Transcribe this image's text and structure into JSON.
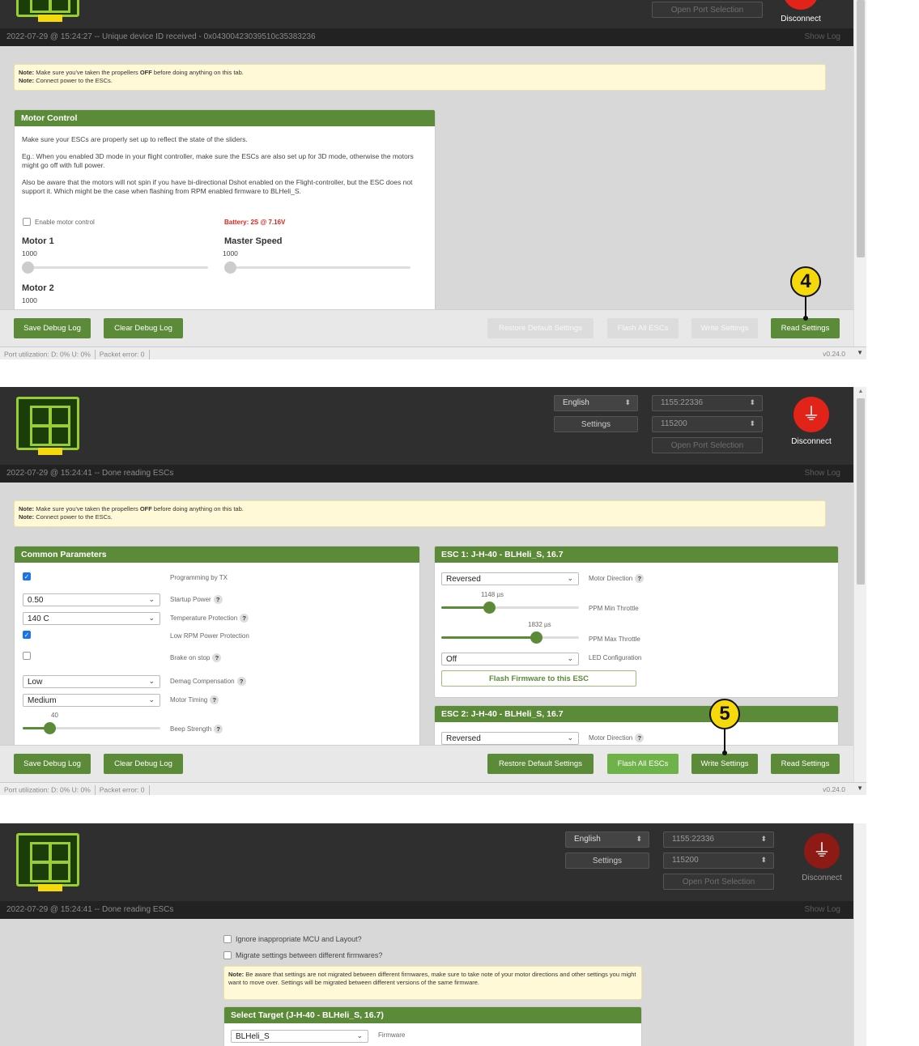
{
  "header": {
    "language": "English",
    "settings_label": "Settings",
    "port": "1155:22336",
    "baud": "115200",
    "open_port_label": "Open Port Selection",
    "disconnect_label": "Disconnect"
  },
  "log": {
    "panel1": "2022-07-29 @ 15:24:27 -- Unique device ID received - 0x04300423039510c35383236",
    "panel2": "2022-07-29 @ 15:24:41 -- Done reading ESCs",
    "panel3": "2022-07-29 @ 15:24:41 -- Done reading ESCs",
    "show_log": "Show Log"
  },
  "notes": {
    "line1_bold": "Note:",
    "line1_a": " Make sure you've taken the propellers ",
    "line1_off": "OFF",
    "line1_b": " before doing anything on this tab.",
    "line2_bold": "Note:",
    "line2": " Connect power to the ESCs."
  },
  "motor_control": {
    "title": "Motor Control",
    "p1": "Make sure your ESCs are properly set up to reflect the state of the sliders.",
    "p2": "Eg.: When you enabled 3D mode in your flight controller, make sure the ESCs are also set up for 3D mode, otherwise the motors might go off with full power.",
    "p3": "Also be aware that the motors will not spin if you have bi-directional Dshot enabled on the Flight-controller, but the ESC does not support it. Which might be the case when flashing from RPM enabled firmware to BLHeli_S.",
    "enable_label": "Enable motor control",
    "battery": "Battery: 2S @ 7.16V",
    "motor1": "Motor 1",
    "motor1_val": "1000",
    "master": "Master Speed",
    "master_val": "1000",
    "motor2": "Motor 2",
    "motor2_val": "1000"
  },
  "toolbar": {
    "save_debug": "Save Debug Log",
    "clear_debug": "Clear Debug Log",
    "restore": "Restore Default Settings",
    "flash_all": "Flash All ESCs",
    "write": "Write Settings",
    "read": "Read Settings"
  },
  "status": {
    "port_util": "Port utilization: D: 0% U: 0%",
    "packet_error": "Packet error: 0",
    "version": "v0.24.0"
  },
  "callouts": {
    "four": "4",
    "five": "5"
  },
  "common": {
    "title": "Common Parameters",
    "programming_by_tx": "Programming by TX",
    "startup_power_val": "0.50",
    "startup_power": "Startup Power",
    "temp_val": "140 C",
    "temp": "Temperature Protection",
    "low_rpm": "Low RPM Power Protection",
    "brake": "Brake on stop",
    "demag_val": "Low",
    "demag": "Demag Compensation",
    "timing_val": "Medium",
    "timing": "Motor Timing",
    "beep_val": "40",
    "beep": "Beep Strength"
  },
  "esc1": {
    "title": "ESC 1: J-H-40 - BLHeli_S, 16.7",
    "direction_val": "Reversed",
    "direction": "Motor Direction",
    "min_val": "1148 µs",
    "min": "PPM Min Throttle",
    "max_val": "1832 µs",
    "max": "PPM Max Throttle",
    "led_val": "Off",
    "led": "LED Configuration",
    "flash": "Flash Firmware to this ESC"
  },
  "esc2": {
    "title": "ESC 2: J-H-40 - BLHeli_S, 16.7",
    "direction_val": "Reversed",
    "direction": "Motor Direction"
  },
  "flash_page": {
    "ignore": "Ignore inappropriate MCU and Layout?",
    "migrate": "Migrate settings between different firmwares?",
    "note_bold": "Note:",
    "note": " Be aware that settings are not migrated between different firmwares, make sure to take note of your motor directions and other settings you might want to move over. Settings will be migrated between different versions of the same firmware.",
    "select_title": "Select Target (J-H-40 - BLHeli_S, 16.7)",
    "firmware_val": "BLHeli_S",
    "firmware": "Firmware"
  },
  "colors": {
    "accent": "#5b8a38",
    "disconnect": "#e2231a",
    "callout": "#f5d90a"
  },
  "icons": {
    "disconnect": "usb-plug-icon",
    "logo": "esc-board-logo"
  }
}
